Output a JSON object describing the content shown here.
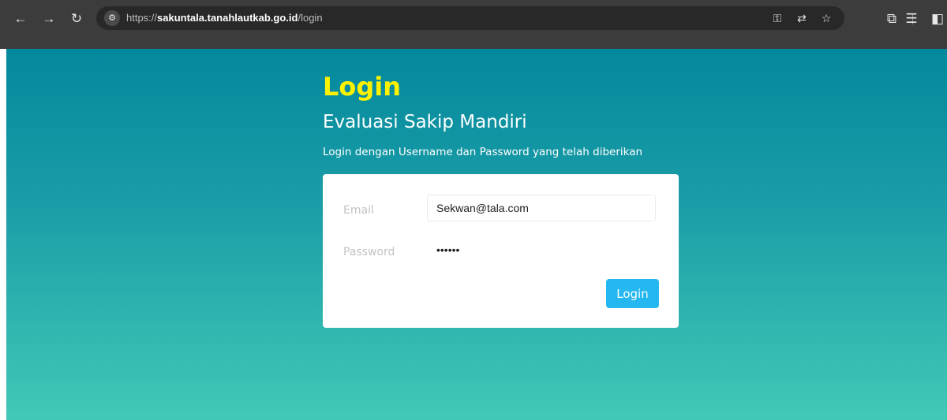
{
  "browser": {
    "url_scheme": "https://",
    "url_host": "sakuntala.tanahlautkab.go.id",
    "url_path": "/login",
    "icons": {
      "back": "back-arrow-icon",
      "forward": "forward-arrow-icon",
      "reload": "reload-icon",
      "site_info": "site-info-icon",
      "password_key": "key-icon",
      "translate": "translate-icon",
      "bookmark": "star-icon",
      "extensions": "puzzle-icon",
      "reading_list": "reading-list-icon",
      "side_panel": "side-panel-icon"
    }
  },
  "page": {
    "heading": "Login",
    "subheading": "Evaluasi Sakip Mandiri",
    "intro": "Login dengan Username dan Password yang telah diberikan",
    "gradient_top": "#03889d",
    "gradient_bottom": "#42c9b6",
    "heading_color": "#fff200"
  },
  "form": {
    "email_label": "Email",
    "email_value": "Sekwan@tala.com",
    "password_label": "Password",
    "password_value": "••••••",
    "submit_label": "Login",
    "button_color": "#25b7ef"
  }
}
